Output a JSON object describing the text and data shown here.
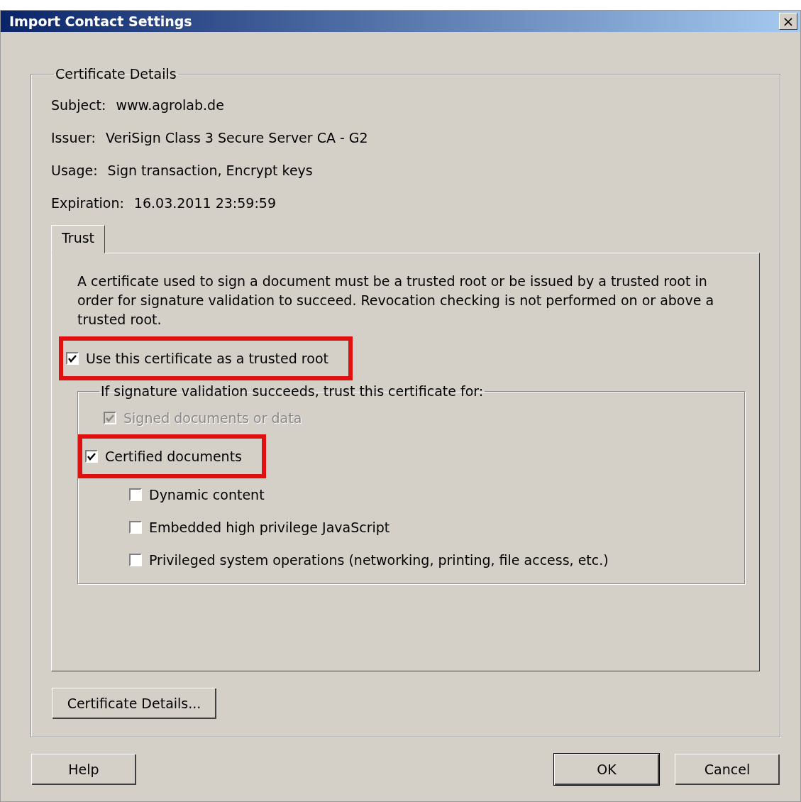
{
  "window": {
    "title": "Import Contact Settings",
    "close": "×"
  },
  "details": {
    "legend": "Certificate Details",
    "fields": [
      {
        "label": "Subject:",
        "value": "www.agrolab.de"
      },
      {
        "label": "Issuer:",
        "value": "VeriSign Class 3 Secure Server CA - G2"
      },
      {
        "label": "Usage:",
        "value": "Sign transaction, Encrypt keys"
      },
      {
        "label": "Expiration:",
        "value": "16.03.2011 23:59:59"
      }
    ]
  },
  "tabs": [
    {
      "label": "Trust",
      "selected": true
    }
  ],
  "trust": {
    "description": "A certificate used to sign a document must be a trusted root or be issued by a trusted root in order for signature validation to succeed.  Revocation checking is not performed on or above a trusted root.",
    "root_option": {
      "label": "Use this certificate as a trusted root",
      "checked": true,
      "disabled": false,
      "highlighted": true
    },
    "group": {
      "legend": "If signature validation succeeds, trust this certificate for:",
      "options": [
        {
          "label": "Signed documents or data",
          "checked": true,
          "disabled": true,
          "highlighted": false
        },
        {
          "label": "Certified documents",
          "checked": true,
          "disabled": false,
          "highlighted": true,
          "children": [
            {
              "label": "Dynamic content",
              "checked": false,
              "disabled": false,
              "highlighted": false
            },
            {
              "label": "Embedded high privilege JavaScript",
              "checked": false,
              "disabled": false,
              "highlighted": false
            },
            {
              "label": "Privileged system operations (networking, printing, file access, etc.)",
              "checked": false,
              "disabled": false,
              "highlighted": false
            }
          ]
        }
      ]
    }
  },
  "details_button": "Certificate Details...",
  "buttons": [
    {
      "label": "Help",
      "default": false
    },
    {
      "label": "OK",
      "default": true
    },
    {
      "label": "Cancel",
      "default": false
    }
  ]
}
